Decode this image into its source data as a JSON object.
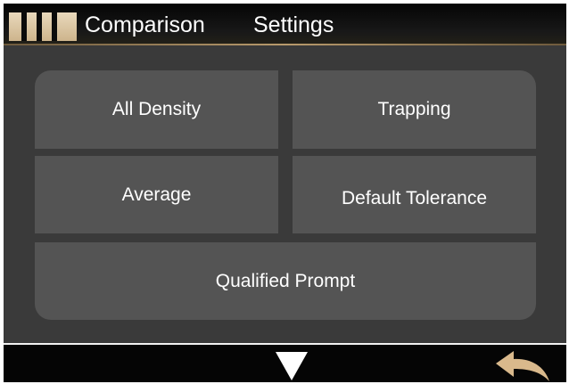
{
  "header": {
    "title": "Comparison",
    "subtitle": "Settings"
  },
  "menu": {
    "all_density": "All Density",
    "trapping": "Trapping",
    "average": "Average",
    "default_tolerance": "Default Tolerance",
    "qualified_prompt": "Qualified Prompt"
  },
  "footer": {
    "down_icon": "down-arrow-icon",
    "back_icon": "back-arrow-icon"
  },
  "colors": {
    "background": "#3a3a3a",
    "button": "#545454",
    "header_bar": "#050505",
    "accent_gold": "#cdb48c",
    "back_arrow": "#d9b98c"
  }
}
